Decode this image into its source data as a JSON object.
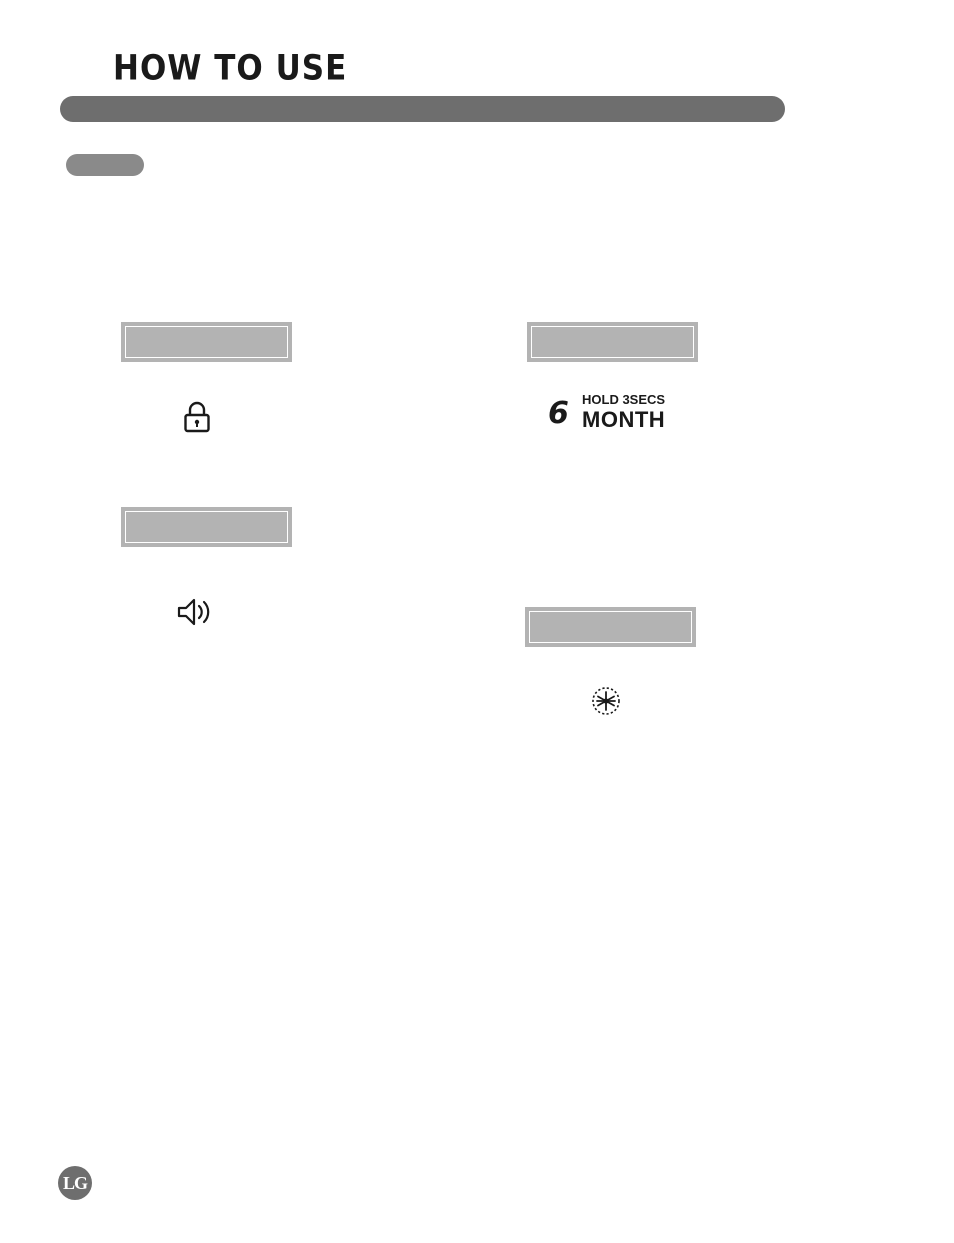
{
  "header": {
    "title": "HOW TO USE",
    "bar_color": "#6e6e6e",
    "pill_color": "#8a8a8a"
  },
  "section": {
    "pill_label": ""
  },
  "features": [
    {
      "key": "lock",
      "box_label": "",
      "icon": "lock-icon",
      "icon_label": ""
    },
    {
      "key": "filter",
      "box_label": "",
      "icon": "filter-digit-icon",
      "digit": "6",
      "hold_text": "HOLD 3SECS",
      "month_text": "MONTH"
    },
    {
      "key": "sound",
      "box_label": "",
      "icon": "speaker-icon",
      "icon_label": ""
    },
    {
      "key": "icemaker",
      "box_label": "",
      "icon": "snowflake-icon",
      "icon_label": ""
    }
  ],
  "footer": {
    "logo_text": "LG"
  },
  "colors": {
    "bar": "#6e6e6e",
    "box_fill": "#b3b3b3",
    "box_inner_border": "#ffffff",
    "text": "#1a1a1a"
  }
}
